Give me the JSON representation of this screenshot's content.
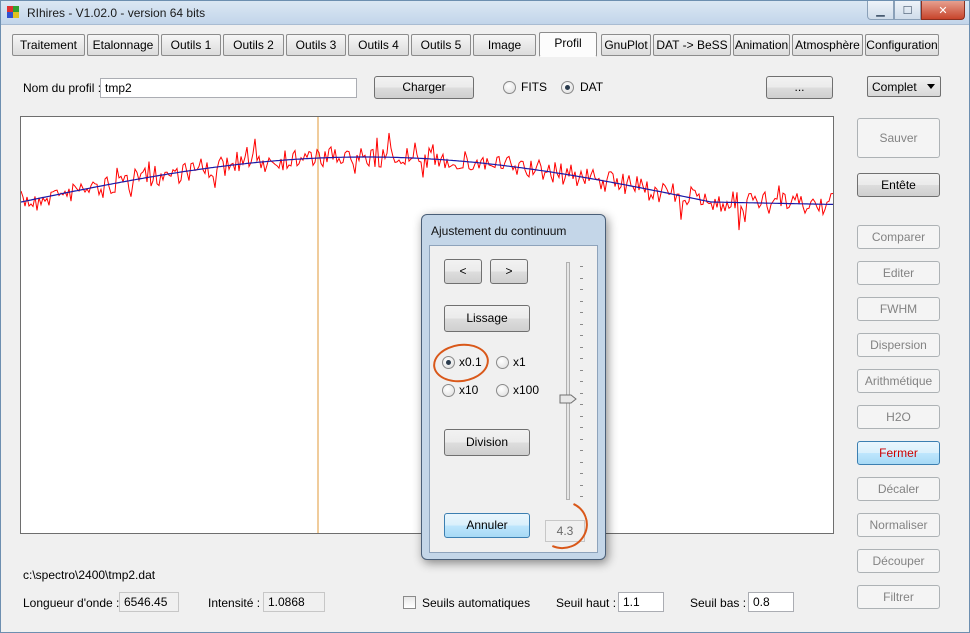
{
  "window": {
    "title": "RIhires - V1.02.0 - version 64 bits",
    "controls": {
      "minimize": "▁",
      "maximize": "☐",
      "close": "✕"
    }
  },
  "tabs": [
    {
      "label": "Traitement"
    },
    {
      "label": "Etalonnage"
    },
    {
      "label": "Outils 1"
    },
    {
      "label": "Outils 2"
    },
    {
      "label": "Outils 3"
    },
    {
      "label": "Outils 4"
    },
    {
      "label": "Outils 5"
    },
    {
      "label": "Image"
    },
    {
      "label": "Profil",
      "active": true
    },
    {
      "label": "GnuPlot"
    },
    {
      "label": "DAT -> BeSS"
    },
    {
      "label": "Animation"
    },
    {
      "label": "Atmosphère"
    },
    {
      "label": "Configuration"
    }
  ],
  "profile": {
    "name_label": "Nom du profil :",
    "name_value": "tmp2",
    "load_button": "Charger",
    "format_fits": "FITS",
    "format_dat": "DAT",
    "selected_format": "DAT",
    "browse_button": "...",
    "mode_select": "Complet"
  },
  "side_buttons": [
    {
      "label": "Sauver",
      "enabled": false
    },
    {
      "label": "Entête",
      "enabled": true
    },
    {
      "label": "Comparer",
      "enabled": false
    },
    {
      "label": "Editer",
      "enabled": false
    },
    {
      "label": "FWHM",
      "enabled": false
    },
    {
      "label": "Dispersion",
      "enabled": false
    },
    {
      "label": "Arithmétique",
      "enabled": false
    },
    {
      "label": "H2O",
      "enabled": false
    },
    {
      "label": "Fermer",
      "enabled": true,
      "highlight": true
    },
    {
      "label": "Décaler",
      "enabled": false
    },
    {
      "label": "Normaliser",
      "enabled": false
    },
    {
      "label": "Découper",
      "enabled": false
    },
    {
      "label": "Filtrer",
      "enabled": false
    }
  ],
  "colors": {
    "spectrum": "#ff0000",
    "continuum": "#1a1aa8",
    "cursor": "#e09a3a",
    "annotation": "#d9581a",
    "close_text": "#cc0000"
  },
  "dialog": {
    "title": "Ajustement du continuum",
    "prev_button": "<",
    "next_button": ">",
    "smooth_button": "Lissage",
    "step_options": [
      "x0.1",
      "x1",
      "x10",
      "x100"
    ],
    "selected_step": "x0.1",
    "division_button": "Division",
    "cancel_button": "Annuler",
    "value": "4.3"
  },
  "status": {
    "file_path": "c:\\spectro\\2400\\tmp2.dat",
    "wavelength_label": "Longueur d'onde :",
    "wavelength_value": "6546.45",
    "intensity_label": "Intensité :",
    "intensity_value": "1.0868",
    "auto_threshold_label": "Seuils automatiques",
    "high_threshold_label": "Seuil haut :",
    "high_threshold_value": "1.1",
    "low_threshold_label": "Seuil bas :",
    "low_threshold_value": "0.8"
  }
}
